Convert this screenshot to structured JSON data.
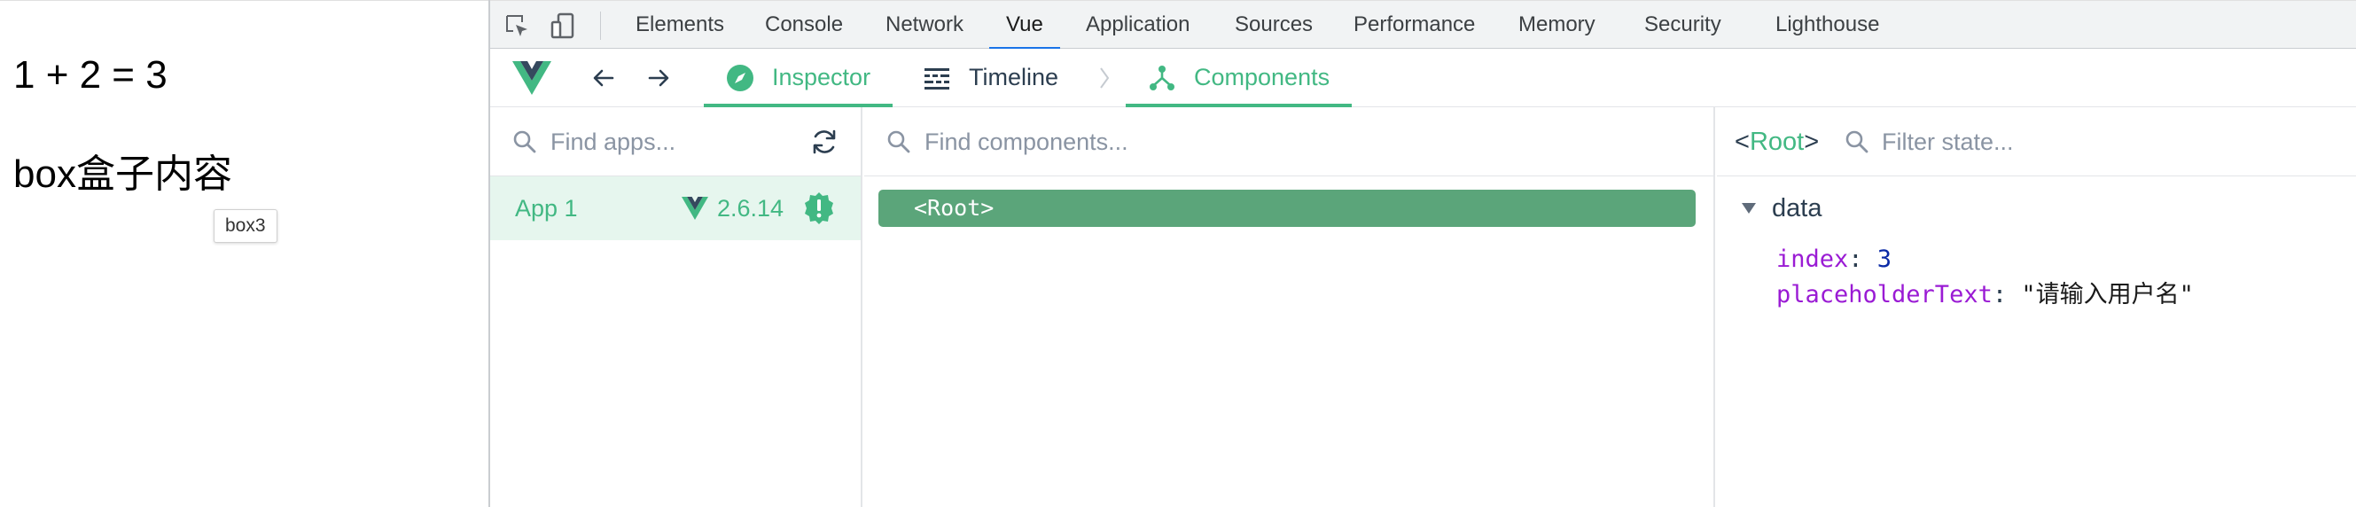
{
  "page": {
    "expression": "1 + 2 = 3",
    "box_text": "box盒子内容",
    "tooltip": "box3"
  },
  "devtools": {
    "tabs": [
      "Elements",
      "Console",
      "Network",
      "Vue",
      "Application",
      "Sources",
      "Performance",
      "Memory",
      "Security",
      "Lighthouse"
    ],
    "active_tab": "Vue"
  },
  "vue": {
    "tabs": {
      "inspector": "Inspector",
      "timeline": "Timeline",
      "components": "Components"
    },
    "apps": {
      "search_placeholder": "Find apps...",
      "items": [
        {
          "name": "App 1",
          "version": "2.6.14"
        }
      ]
    },
    "components": {
      "search_placeholder": "Find components...",
      "root": "<Root>"
    },
    "state": {
      "root_open": "<",
      "root_name": "Root",
      "root_close": ">",
      "filter_placeholder": "Filter state...",
      "section": "data",
      "props": [
        {
          "key": "index",
          "value": "3"
        },
        {
          "key": "placeholderText",
          "value": "\"请输入用户名\""
        }
      ]
    }
  },
  "colors": {
    "vue_green": "#42b883",
    "selected_row": "#5ba57a",
    "active_tab_underline": "#1a73e8"
  },
  "icons": [
    "select-element-icon",
    "device-toggle-icon",
    "vue-logo-icon",
    "back-arrow-icon",
    "forward-arrow-icon",
    "compass-icon",
    "timeline-icon",
    "components-icon",
    "search-icon",
    "refresh-icon",
    "warning-badge-icon",
    "triangle-down-icon"
  ]
}
